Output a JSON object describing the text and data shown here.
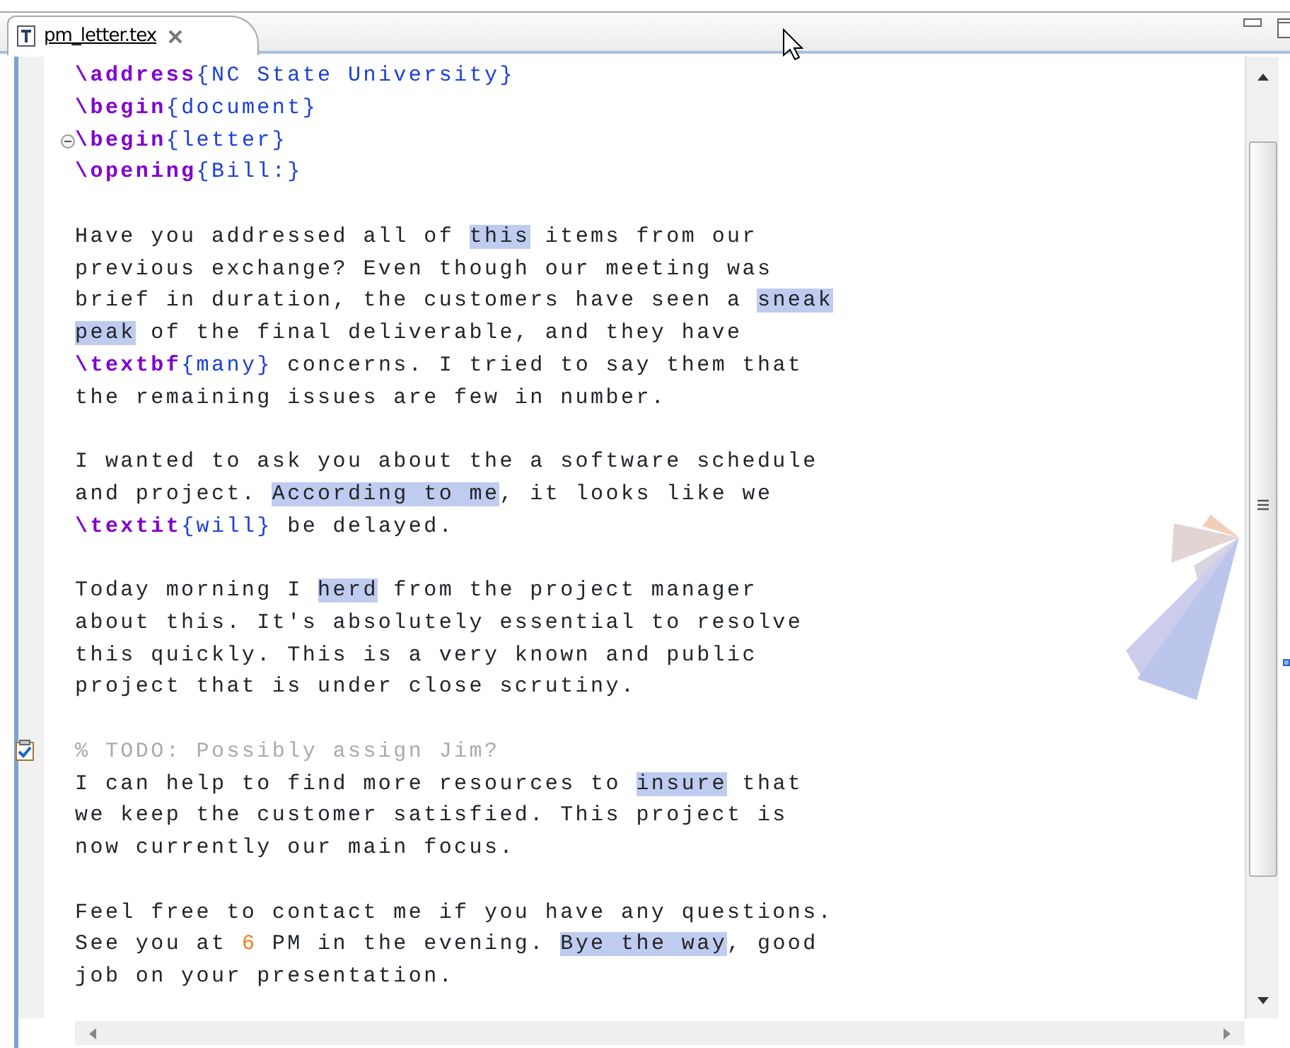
{
  "tab": {
    "label": "pm_letter.tex",
    "selected": true
  },
  "lines": [
    {
      "segments": [
        {
          "kind": "command",
          "text": "\\address"
        },
        {
          "kind": "arg",
          "text": "{NC State University}"
        }
      ]
    },
    {
      "segments": [
        {
          "kind": "command",
          "text": "\\begin"
        },
        {
          "kind": "arg",
          "text": "{document}"
        }
      ]
    },
    {
      "kind": "fold",
      "expanded": true,
      "segments": [
        {
          "kind": "command",
          "text": "\\begin"
        },
        {
          "kind": "arg",
          "text": "{letter}"
        }
      ]
    },
    {
      "segments": [
        {
          "kind": "command",
          "text": "\\opening"
        },
        {
          "kind": "arg",
          "text": "{Bill:}"
        }
      ]
    },
    {
      "kind": "blank"
    },
    {
      "segments": [
        {
          "kind": "text",
          "text": "Have you addressed all of "
        },
        {
          "kind": "mark",
          "text": "this"
        },
        {
          "kind": "text",
          "text": " items from our"
        }
      ]
    },
    {
      "segments": [
        {
          "kind": "text",
          "text": "previous exchange? Even though our meeting was"
        }
      ]
    },
    {
      "segments": [
        {
          "kind": "text",
          "text": "brief in duration, the customers have seen a "
        },
        {
          "kind": "mark",
          "text": "sneak"
        }
      ]
    },
    {
      "segments": [
        {
          "kind": "mark",
          "text": "peak"
        },
        {
          "kind": "text",
          "text": " of the final deliverable, and they have"
        }
      ]
    },
    {
      "segments": [
        {
          "kind": "command",
          "text": "\\textbf"
        },
        {
          "kind": "arg",
          "text": "{many}"
        },
        {
          "kind": "text",
          "text": " concerns. I tried to say them that"
        }
      ]
    },
    {
      "segments": [
        {
          "kind": "text",
          "text": "the remaining issues are few in number."
        }
      ]
    },
    {
      "kind": "blank"
    },
    {
      "segments": [
        {
          "kind": "text",
          "text": "I wanted to ask you about the a software schedule"
        }
      ]
    },
    {
      "segments": [
        {
          "kind": "text",
          "text": "and project. "
        },
        {
          "kind": "mark",
          "text": "According to me"
        },
        {
          "kind": "text",
          "text": ", it looks like we"
        }
      ]
    },
    {
      "segments": [
        {
          "kind": "command",
          "text": "\\textit"
        },
        {
          "kind": "arg",
          "text": "{will}"
        },
        {
          "kind": "text",
          "text": " be delayed."
        }
      ]
    },
    {
      "kind": "blank"
    },
    {
      "segments": [
        {
          "kind": "text",
          "text": "Today morning I "
        },
        {
          "kind": "mark",
          "text": "herd"
        },
        {
          "kind": "text",
          "text": " from the project manager"
        }
      ]
    },
    {
      "segments": [
        {
          "kind": "text",
          "text": "about this. It's absolutely essential to resolve"
        }
      ]
    },
    {
      "segments": [
        {
          "kind": "text",
          "text": "this quickly. This is a very known and public"
        }
      ]
    },
    {
      "segments": [
        {
          "kind": "text",
          "text": "project that is under close scrutiny."
        }
      ]
    },
    {
      "kind": "blank"
    },
    {
      "kind": "task",
      "segments": [
        {
          "kind": "comment",
          "text": "% TODO: Possibly assign Jim?"
        }
      ]
    },
    {
      "segments": [
        {
          "kind": "text",
          "text": "I can help to find more resources to "
        },
        {
          "kind": "mark",
          "text": "insure"
        },
        {
          "kind": "text",
          "text": " that"
        }
      ]
    },
    {
      "segments": [
        {
          "kind": "text",
          "text": "we keep the customer satisfied. This project is"
        }
      ]
    },
    {
      "segments": [
        {
          "kind": "text",
          "text": "now currently our main focus."
        }
      ]
    },
    {
      "kind": "blank"
    },
    {
      "segments": [
        {
          "kind": "text",
          "text": "Feel free to contact me if you have any questions."
        }
      ]
    },
    {
      "segments": [
        {
          "kind": "text",
          "text": "See you at "
        },
        {
          "kind": "number",
          "text": "6"
        },
        {
          "kind": "text",
          "text": " PM in the evening. "
        },
        {
          "kind": "mark",
          "text": "Bye the way"
        },
        {
          "kind": "text",
          "text": ", good"
        }
      ]
    },
    {
      "segments": [
        {
          "kind": "text",
          "text": "job on your presentation."
        }
      ]
    }
  ]
}
